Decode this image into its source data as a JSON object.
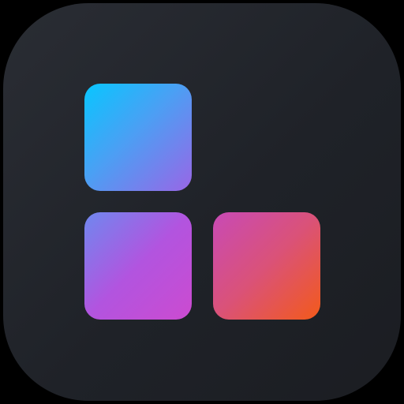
{
  "app_icon": {
    "background_colors": [
      "#2a2d34",
      "#1b1d22"
    ],
    "tiles": [
      {
        "name": "top-left",
        "colors": [
          "#08c6ff",
          "#9966e6"
        ]
      },
      {
        "name": "bottom-left",
        "colors": [
          "#6f88ef",
          "#cc4bd0"
        ]
      },
      {
        "name": "bottom-right",
        "colors": [
          "#c84ab6",
          "#f35a1a"
        ]
      }
    ]
  }
}
